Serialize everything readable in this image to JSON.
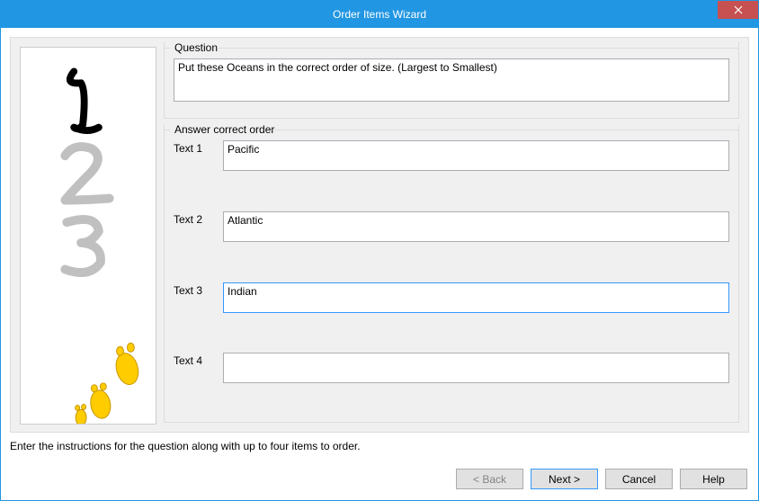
{
  "window": {
    "title": "Order Items Wizard"
  },
  "question": {
    "group_label": "Question",
    "label": "Question",
    "value": "Put these Oceans in the correct order of size. (Largest to Smallest)"
  },
  "answers": {
    "group_label": "Answer correct order",
    "items": [
      {
        "label": "Text 1",
        "value": "Pacific"
      },
      {
        "label": "Text 2",
        "value": "Atlantic"
      },
      {
        "label": "Text 3",
        "value": "Indian"
      },
      {
        "label": "Text 4",
        "value": ""
      }
    ]
  },
  "hint": "Enter the instructions for the question along with up to four items to order.",
  "buttons": {
    "back": "< Back",
    "next": "Next >",
    "cancel": "Cancel",
    "help": "Help"
  }
}
